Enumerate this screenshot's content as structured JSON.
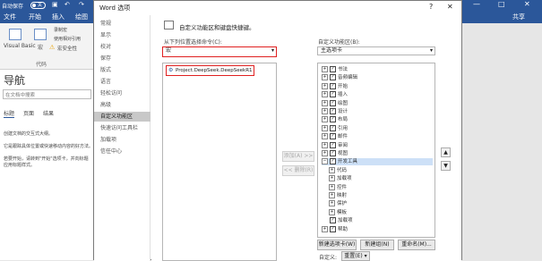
{
  "word": {
    "autosave": "自动保存",
    "toggle": "关",
    "tabs": [
      "文件",
      "开始",
      "插入",
      "绘图"
    ],
    "right_tabs": [
      "共享"
    ],
    "ribbon": {
      "visual_basic": "Visual Basic",
      "macros": "宏",
      "record_macro": "录制宏",
      "relative_ref": "使用相对引用",
      "macro_security": "宏安全性",
      "group": "代码"
    },
    "nav": {
      "title": "导航",
      "search_placeholder": "在文档中搜索",
      "tabs": [
        "标题",
        "页面",
        "结果"
      ],
      "text1": "创建文档的交互式大纲。",
      "text2": "它是跟踪具体位置或快速移动内容的好方法。",
      "text3": "若要开始，请转到\"开始\"选项卡，并向标题应用标题样式。"
    }
  },
  "dialog": {
    "title": "Word 选项",
    "help": "?",
    "close": "✕",
    "sidebar": [
      "常规",
      "显示",
      "校对",
      "保存",
      "版式",
      "语言",
      "轻松访问",
      "高级",
      "自定义功能区",
      "快速访问工具栏",
      "加载项",
      "信任中心"
    ],
    "selected_index": 8,
    "heading": "自定义功能区和键盘快捷键。",
    "choose_label": "从下列位置选择命令(C):",
    "choose_value": "宏",
    "customize_label": "自定义功能区(B):",
    "customize_value": "主选项卡",
    "macro_item": "Project.DeepSeek.DeepSeekR1",
    "add_button": "添加(A) >>",
    "remove_button": "<< 删除(R)",
    "tree": [
      {
        "indent": 0,
        "pm": "⊞",
        "check": true,
        "text": "书法"
      },
      {
        "indent": 0,
        "pm": "⊞",
        "check": true,
        "text": "音频编辑"
      },
      {
        "indent": 0,
        "pm": "⊞",
        "check": true,
        "text": "开始"
      },
      {
        "indent": 0,
        "pm": "⊞",
        "check": true,
        "text": "插入"
      },
      {
        "indent": 0,
        "pm": "⊞",
        "check": true,
        "text": "绘图"
      },
      {
        "indent": 0,
        "pm": "⊞",
        "check": true,
        "text": "设计"
      },
      {
        "indent": 0,
        "pm": "⊞",
        "check": true,
        "text": "布局"
      },
      {
        "indent": 0,
        "pm": "⊞",
        "check": true,
        "text": "引用"
      },
      {
        "indent": 0,
        "pm": "⊞",
        "check": true,
        "text": "邮件"
      },
      {
        "indent": 0,
        "pm": "⊞",
        "check": true,
        "text": "审阅"
      },
      {
        "indent": 0,
        "pm": "⊞",
        "check": true,
        "text": "视图"
      },
      {
        "indent": 0,
        "pm": "⊟",
        "check": true,
        "text": "开发工具",
        "selected": true
      },
      {
        "indent": 1,
        "pm": "⊞",
        "check": false,
        "text": "代码"
      },
      {
        "indent": 1,
        "pm": "⊞",
        "check": false,
        "text": "加载项"
      },
      {
        "indent": 1,
        "pm": "⊞",
        "check": false,
        "text": "控件"
      },
      {
        "indent": 1,
        "pm": "⊞",
        "check": false,
        "text": "映射"
      },
      {
        "indent": 1,
        "pm": "⊞",
        "check": false,
        "text": "保护"
      },
      {
        "indent": 1,
        "pm": "⊞",
        "check": false,
        "text": "模板"
      },
      {
        "indent": 0,
        "pm": "",
        "check": true,
        "text": "加载项"
      },
      {
        "indent": 0,
        "pm": "⊞",
        "check": true,
        "text": "帮助"
      }
    ],
    "new_tab_button": "新建选项卡(W)",
    "new_group_button": "新建组(N)",
    "rename_button": "重命名(M)...",
    "custom_label": "自定义:",
    "reset_button": "重置(E) ▾"
  }
}
